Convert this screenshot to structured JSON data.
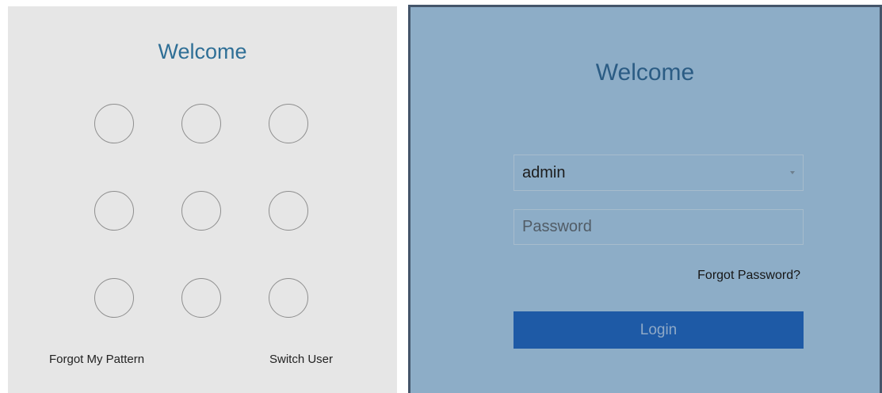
{
  "pattern_panel": {
    "title": "Welcome",
    "forgot_label": "Forgot My Pattern",
    "switch_user_label": "Switch User"
  },
  "login_panel": {
    "title": "Welcome",
    "username_value": "admin",
    "password_placeholder": "Password",
    "forgot_password_label": "Forgot Password?",
    "login_label": "Login"
  },
  "colors": {
    "pattern_background": "#e6e6e6",
    "login_background": "#8dadc7",
    "title_blue": "#2f6f96",
    "login_button": "#1e5aa6",
    "login_button_text": "#8fa9c7",
    "panel_border": "#44556a"
  },
  "icons": {
    "username_dropdown": "chevron-down-icon"
  }
}
